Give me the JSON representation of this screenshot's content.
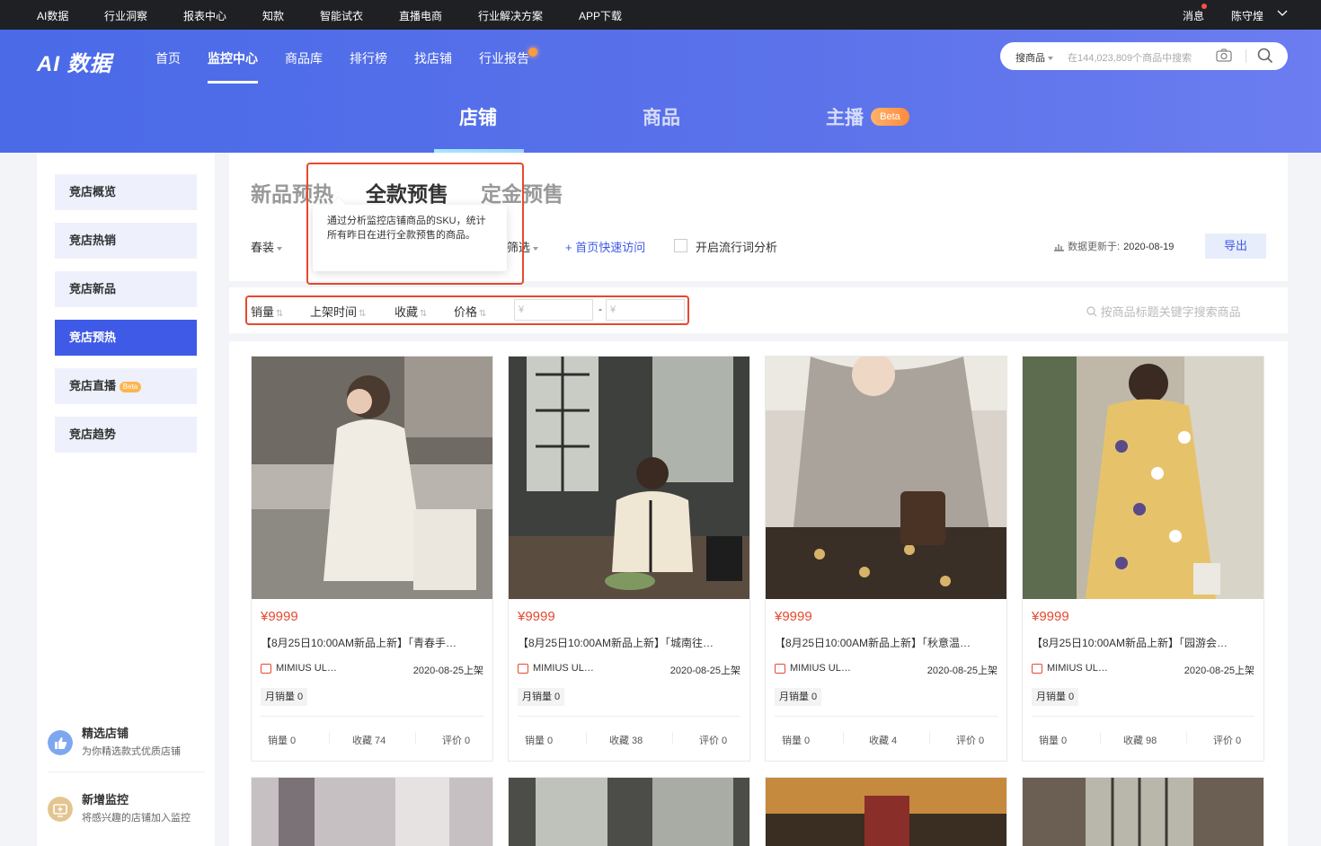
{
  "topbar": {
    "links": [
      "AI数据",
      "行业洞察",
      "报表中心",
      "知款",
      "智能试衣",
      "直播电商",
      "行业解决方案",
      "APP下载"
    ],
    "message": "消息",
    "user": "陈守煌"
  },
  "header": {
    "logo": "AI 数据",
    "nav": [
      "首页",
      "监控中心",
      "商品库",
      "排行榜",
      "找店铺",
      "行业报告"
    ],
    "active_nav": "监控中心",
    "search": {
      "select": "搜商品",
      "placeholder": "在144,023,809个商品中搜索"
    },
    "subtabs": [
      "店铺",
      "商品",
      "主播"
    ],
    "active_subtab": "店铺",
    "beta": "Beta"
  },
  "sidebar": {
    "items": [
      "竞店概览",
      "竞店热销",
      "竞店新品",
      "竞店预热",
      "竞店直播",
      "竞店趋势"
    ],
    "active": "竞店预热",
    "beta": "Beta",
    "promos": [
      {
        "title": "精选店铺",
        "subtitle": "为你精选款式优质店铺"
      },
      {
        "title": "新增监控",
        "subtitle": "将感兴趣的店铺加入监控"
      }
    ]
  },
  "content_tabs": [
    "新品预热",
    "全款预售",
    "定金预售"
  ],
  "active_content_tab": "全款预售",
  "tooltip": "通过分析监控店铺商品的SKU，统计所有昨日在进行全款预售的商品。",
  "filters": {
    "season": "春装",
    "filter": "筛选",
    "quick_access": "+ 首页快速访问",
    "trend_toggle": "开启流行词分析",
    "update_label": "数据更新于:",
    "update_date": "2020-08-19",
    "export": "导出"
  },
  "sort": {
    "items": [
      "销量",
      "上架时间",
      "收藏",
      "价格"
    ],
    "price_min_placeholder": "¥",
    "price_max_placeholder": "¥",
    "dash": "-",
    "keyword_placeholder": "按商品标题关键字搜索商品"
  },
  "products": [
    {
      "price": "¥9999",
      "title": "【8月25日10:00AM新品上新】「青春手…",
      "shop": "MIMIUS UL…",
      "date": "2020-08-25上架",
      "monthly": "月销量 0",
      "sales": "销量 0",
      "fav": "收藏 74",
      "review": "评价  0"
    },
    {
      "price": "¥9999",
      "title": "【8月25日10:00AM新品上新】「城南往…",
      "shop": "MIMIUS UL…",
      "date": "2020-08-25上架",
      "monthly": "月销量 0",
      "sales": "销量 0",
      "fav": "收藏 38",
      "review": "评价  0"
    },
    {
      "price": "¥9999",
      "title": "【8月25日10:00AM新品上新】「秋意温…",
      "shop": "MIMIUS UL…",
      "date": "2020-08-25上架",
      "monthly": "月销量 0",
      "sales": "销量 0",
      "fav": "收藏 4",
      "review": "评价  0"
    },
    {
      "price": "¥9999",
      "title": "【8月25日10:00AM新品上新】「园游会…",
      "shop": "MIMIUS UL…",
      "date": "2020-08-25上架",
      "monthly": "月销量 0",
      "sales": "销量 0",
      "fav": "收藏 98",
      "review": "评价  0"
    }
  ],
  "colors": {
    "primary": "#3f5ae6",
    "price": "#e8482f",
    "highlight_box": "#e8482f",
    "topbar": "#1f2024"
  }
}
